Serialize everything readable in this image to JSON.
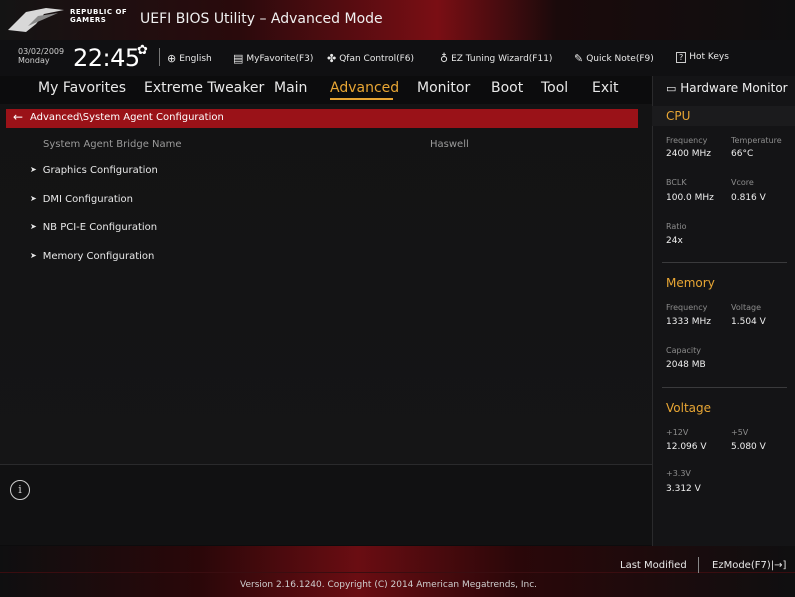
{
  "header": {
    "brand_line1": "REPUBLIC OF",
    "brand_line2": "GAMERS",
    "title": "UEFI BIOS Utility – Advanced Mode"
  },
  "toolbar": {
    "date": "03/02/2009",
    "day": "Monday",
    "time": "22:45",
    "items": [
      {
        "label": "English",
        "icon": "globe-icon"
      },
      {
        "label": "MyFavorite(F3)",
        "icon": "favorite-icon"
      },
      {
        "label": "Qfan Control(F6)",
        "icon": "fan-icon"
      },
      {
        "label": "EZ Tuning Wizard(F11)",
        "icon": "bulb-icon"
      },
      {
        "label": "Quick Note(F9)",
        "icon": "note-icon"
      },
      {
        "label": "Hot Keys",
        "icon": "question-icon"
      }
    ]
  },
  "nav": {
    "tabs": [
      "My Favorites",
      "Extreme Tweaker",
      "Main",
      "Advanced",
      "Monitor",
      "Boot",
      "Tool",
      "Exit"
    ],
    "active": "Advanced"
  },
  "main": {
    "breadcrumb": "Advanced\\System Agent Configuration",
    "system_agent_label": "System Agent Bridge Name",
    "system_agent_value": "Haswell",
    "submenus": [
      "Graphics Configuration",
      "DMI Configuration",
      "NB PCI-E Configuration",
      "Memory Configuration"
    ]
  },
  "monitor": {
    "title": "Hardware Monitor",
    "cpu": {
      "section": "CPU",
      "frequency_label": "Frequency",
      "frequency": "2400 MHz",
      "temperature_label": "Temperature",
      "temperature": "66°C",
      "bclk_label": "BCLK",
      "bclk": "100.0 MHz",
      "vcore_label": "Vcore",
      "vcore": "0.816 V",
      "ratio_label": "Ratio",
      "ratio": "24x"
    },
    "memory": {
      "section": "Memory",
      "frequency_label": "Frequency",
      "frequency": "1333 MHz",
      "voltage_label": "Voltage",
      "voltage": "1.504 V",
      "capacity_label": "Capacity",
      "capacity": "2048 MB"
    },
    "voltage": {
      "section": "Voltage",
      "v12_label": "+12V",
      "v12": "12.096 V",
      "v5_label": "+5V",
      "v5": "5.080 V",
      "v33_label": "+3.3V",
      "v33": "3.312 V"
    }
  },
  "footer": {
    "last_modified": "Last Modified",
    "ezmode": "EzMode(F7)",
    "version": "Version 2.16.1240. Copyright (C) 2014 American Megatrends, Inc."
  },
  "colors": {
    "accent": "#e8a634",
    "highlight_bar": "#9a1218",
    "background": "#0c0c0d"
  }
}
